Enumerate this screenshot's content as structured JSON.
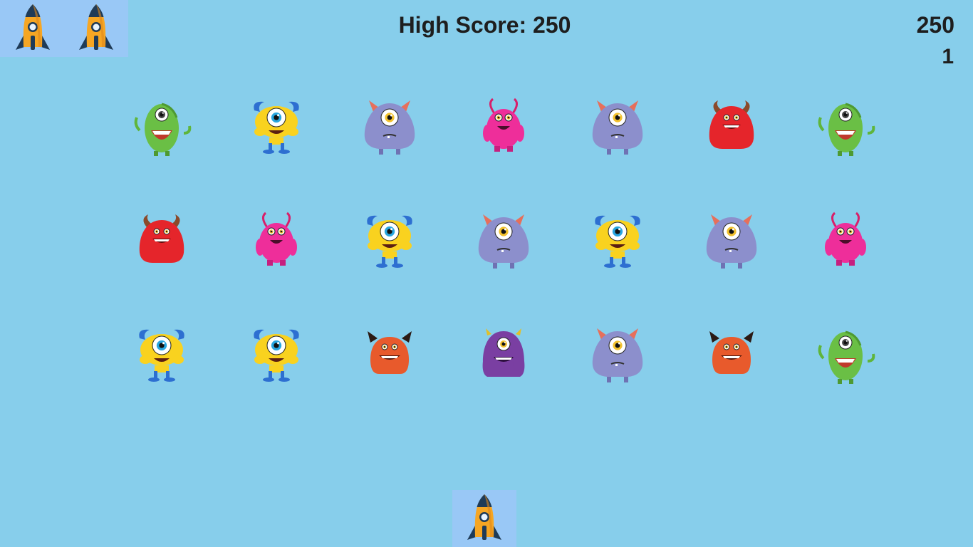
{
  "hud": {
    "high_score_text": "High Score: 250",
    "score": "250",
    "level": "1",
    "lives_remaining": 2
  },
  "colors": {
    "background": "#87ceeb",
    "hud_panel": "#99c8f6",
    "rocket_body": "#f6a623",
    "rocket_dark": "#1f3b57"
  },
  "monster_grid": [
    [
      "green-cyclops",
      "yellow-horned",
      "purple-blob",
      "pink-antenna",
      "purple-blob",
      "red-horned",
      "green-cyclops"
    ],
    [
      "red-horned",
      "pink-antenna",
      "yellow-horned",
      "purple-blob",
      "yellow-horned",
      "purple-blob",
      "pink-antenna"
    ],
    [
      "yellow-horned",
      "yellow-horned",
      "orange-devil",
      "violet-cyclops",
      "purple-blob",
      "orange-devil",
      "green-cyclops"
    ]
  ]
}
